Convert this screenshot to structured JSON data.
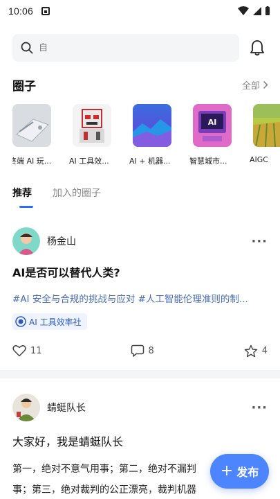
{
  "status_bar": {
    "time": "10:06"
  },
  "search": {
    "placeholder": "自"
  },
  "circles_section": {
    "title": "圈子",
    "see_all": "全部",
    "items": [
      {
        "label": "终端 AI 玩...",
        "icon": "device-thumbnail"
      },
      {
        "label": "AI 工具效...",
        "icon": "robot-thumbnail"
      },
      {
        "label": "AI + 机器...",
        "icon": "landscape-thumbnail"
      },
      {
        "label": "智慧城市...",
        "icon": "ai-monitor-thumbnail"
      },
      {
        "label": "AIGC",
        "icon": "field-thumbnail"
      }
    ]
  },
  "tabs": [
    {
      "label": "推荐",
      "active": true
    },
    {
      "label": "加入的圈子",
      "active": false
    }
  ],
  "posts": [
    {
      "author": "杨金山",
      "title": "AI是否可以替代人类?",
      "tags": "#AI 安全与合规的挑战与应对 #人工智能伦理准则的制...",
      "circle": "AI 工具效率社",
      "likes": "11",
      "comments": "8",
      "stars": "4"
    },
    {
      "author": "蜻蜓队长",
      "title": "大家好，我是蜻蜓队长",
      "body_line1": "第一，绝对不意气用事；第二，绝对不漏判",
      "body_line2": "事；第三，绝对裁判的公正漂亮，裁判机器"
    }
  ],
  "publish_button": {
    "label": "发布"
  },
  "colors": {
    "accent": "#4d84ff",
    "tag": "#4a6fb8",
    "underline": "#2d6bff"
  }
}
